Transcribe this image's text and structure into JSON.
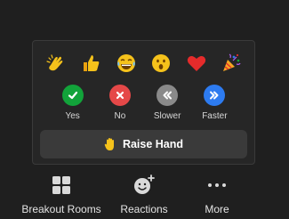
{
  "reactions_panel": {
    "emojis": [
      {
        "name": "clapping-hands",
        "icon": "clap-icon"
      },
      {
        "name": "thumbs-up",
        "icon": "thumbs-up-icon"
      },
      {
        "name": "tears-of-joy",
        "icon": "laughing-face-icon"
      },
      {
        "name": "open-mouth",
        "icon": "surprised-face-icon"
      },
      {
        "name": "red-heart",
        "icon": "heart-icon"
      },
      {
        "name": "party-popper",
        "icon": "party-popper-icon"
      }
    ],
    "feedback": [
      {
        "label": "Yes",
        "icon": "check-icon",
        "color": "#12a33a"
      },
      {
        "label": "No",
        "icon": "x-icon",
        "color": "#e54848"
      },
      {
        "label": "Slower",
        "icon": "rewind-icon",
        "color": "#8a8a8a"
      },
      {
        "label": "Faster",
        "icon": "fast-forward-icon",
        "color": "#2d7bf0"
      }
    ],
    "raise_hand_label": "Raise Hand"
  },
  "toolbar": {
    "breakout_label": "Breakout Rooms",
    "reactions_label": "Reactions",
    "more_label": "More"
  }
}
